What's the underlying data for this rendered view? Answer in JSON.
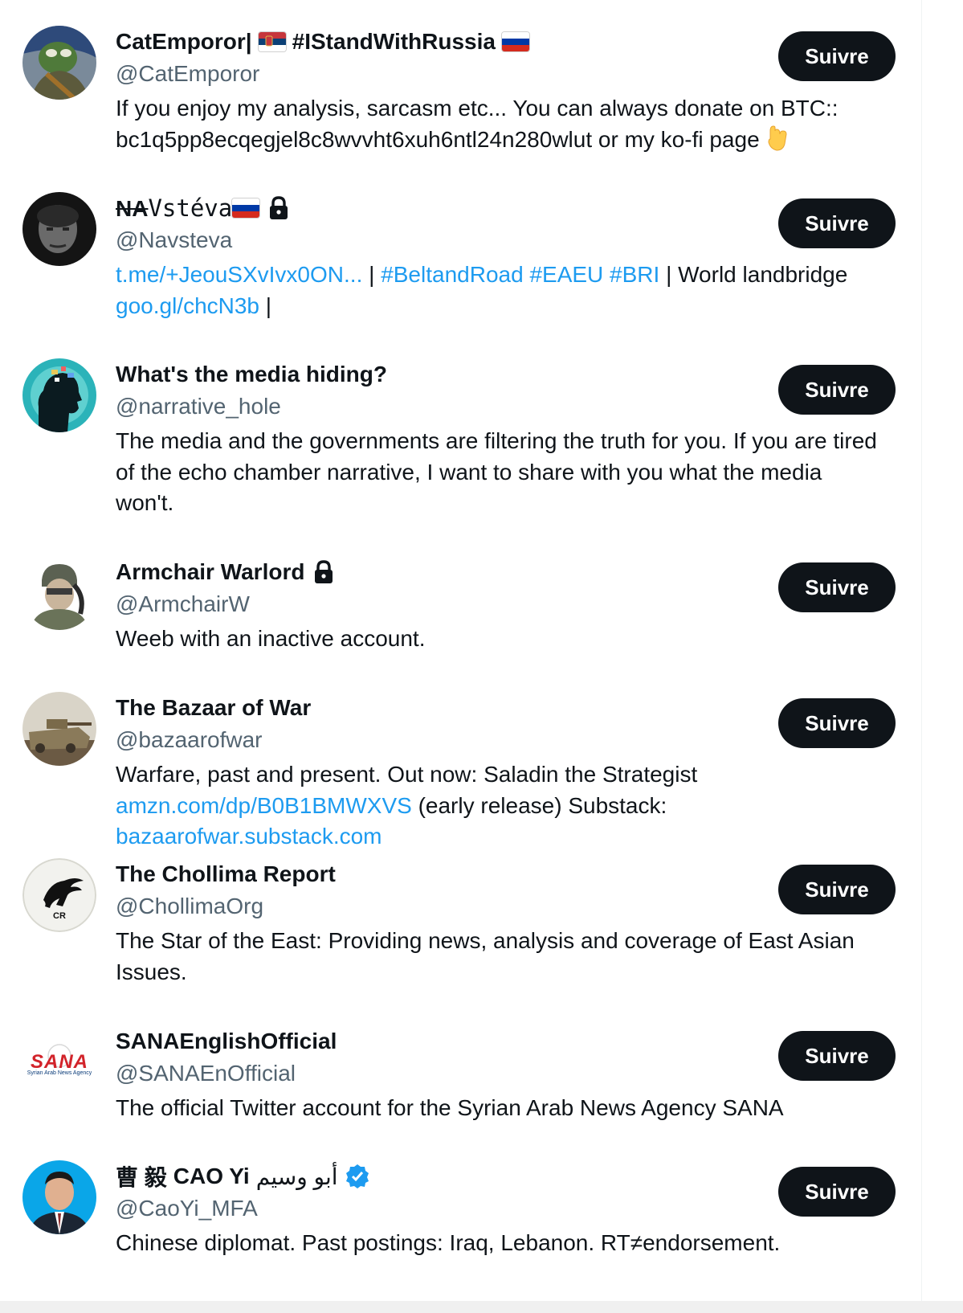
{
  "follow_label": "Suivre",
  "accounts": [
    {
      "name": "CatEmporor|",
      "name_tag": "#IStandWithRussia",
      "handle": "@CatEmporor",
      "bio_text": "If you enjoy my analysis, sarcasm etc... You can always donate on BTC:: bc1q5pp8ecqegjel8c8wvvht6xuh6ntl24n280wlut or my ko-fi page",
      "icons": [
        "serbia-flag",
        "russia-flag",
        "pointing-down-emoji"
      ]
    },
    {
      "name_strike": "NA",
      "name_mono": "Vstéva",
      "handle": "@Navsteva",
      "bio_link1": "t.me/+JeouSXvIvx0ON...",
      "bio_sep1": " | ",
      "bio_link2": "#BeltandRoad #EAEU #BRI",
      "bio_text": " | World landbridge ",
      "bio_link3": "goo.gl/chcN3b",
      "bio_tail": " |",
      "icons": [
        "russia-flag",
        "lock-icon"
      ]
    },
    {
      "name": "What's the media hiding?",
      "handle": "@narrative_hole",
      "bio_text": "The media and the governments are filtering the truth for you. If you are tired of the echo chamber narrative, I want to share with you what the media won't."
    },
    {
      "name": "Armchair Warlord",
      "handle": "@ArmchairW",
      "bio_text": "Weeb with an inactive account.",
      "icons": [
        "lock-icon"
      ]
    },
    {
      "name": "The Bazaar of War",
      "handle": "@bazaarofwar",
      "bio_text1": "Warfare, past and present. Out now: Saladin the Strategist ",
      "bio_link1": "amzn.com/dp/B0B1BMWXVS",
      "bio_text2": " (early release) Substack: ",
      "bio_link2": "bazaarofwar.substack.com"
    },
    {
      "name": "The Chollima Report",
      "handle": "@ChollimaOrg",
      "bio_text": "The Star of the East: Providing news, analysis and coverage of East Asian Issues.",
      "avatar_text": "CR"
    },
    {
      "name": "SANAEnglishOfficial",
      "handle": "@SANAEnOfficial",
      "bio_text": "The official Twitter account for the Syrian Arab News Agency SANA",
      "avatar_logo": "SANA",
      "avatar_sub": "Syrian Arab News Agency"
    },
    {
      "name_cjk": "曹 毅",
      "name": "CAO Yi",
      "name_ar": "أبو وسيم",
      "handle": "@CaoYi_MFA",
      "bio_text": "Chinese diplomat. Past postings: Iraq, Lebanon. RT≠endorsement.",
      "icons": [
        "verified-badge"
      ]
    }
  ],
  "colors": {
    "link": "#1d9bf0",
    "handle": "#536471",
    "button": "#0f1419",
    "text": "#0f1419"
  }
}
